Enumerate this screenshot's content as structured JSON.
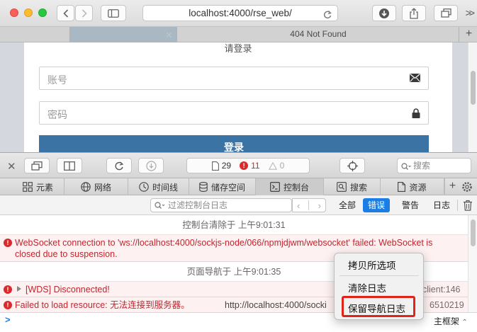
{
  "browser": {
    "url": "localhost:4000/rse_web/",
    "tabs": [
      {
        "label": "",
        "active": true
      },
      {
        "label": "404 Not Found",
        "active": false
      }
    ]
  },
  "page": {
    "card_title": "请登录",
    "username_placeholder": "账号",
    "password_placeholder": "密码",
    "login_button": "登录"
  },
  "inspector": {
    "resource_count": "29",
    "error_count": "11",
    "warning_count": "0",
    "search_placeholder": "搜索",
    "tabs": [
      {
        "label": "元素",
        "icon": "elements-icon"
      },
      {
        "label": "网络",
        "icon": "network-icon"
      },
      {
        "label": "时间线",
        "icon": "timeline-icon"
      },
      {
        "label": "储存空间",
        "icon": "storage-icon"
      },
      {
        "label": "控制台",
        "icon": "console-icon",
        "active": true
      },
      {
        "label": "搜索",
        "icon": "search-icon"
      },
      {
        "label": "资源",
        "icon": "resources-icon"
      }
    ],
    "filter_placeholder": "过滤控制台日志",
    "filter_buttons": [
      {
        "label": "全部",
        "selected": false
      },
      {
        "label": "错误",
        "selected": true
      },
      {
        "label": "警告",
        "selected": false
      },
      {
        "label": "日志",
        "selected": false
      }
    ],
    "frame_selector": "主框架"
  },
  "console": {
    "cleared_msg": "控制台清除于 上午9:01:31",
    "ws_error_line1": "WebSocket connection to 'ws://localhost:4000/sockjs-node/066/npmjdjwm/websocket' failed: WebSocket is",
    "ws_error_line2": "closed due to suspension.",
    "nav_msg": "页面导航于 上午9:01:35",
    "wds_error": "[WDS] Disconnected!",
    "wds_location": "client:146",
    "load_error": "Failed to load resource: 无法连接到服务器。",
    "load_url": "http://localhost:4000/socki",
    "load_location": "6510219"
  },
  "context_menu": {
    "items": [
      "拷贝所选项",
      "清除日志",
      "保留导航日志"
    ],
    "highlighted": "保留导航日志"
  },
  "colors": {
    "accent": "#1a7ee6",
    "error": "#c0262e",
    "login_button": "#3a73a4",
    "highlight_box": "#e0241b"
  }
}
